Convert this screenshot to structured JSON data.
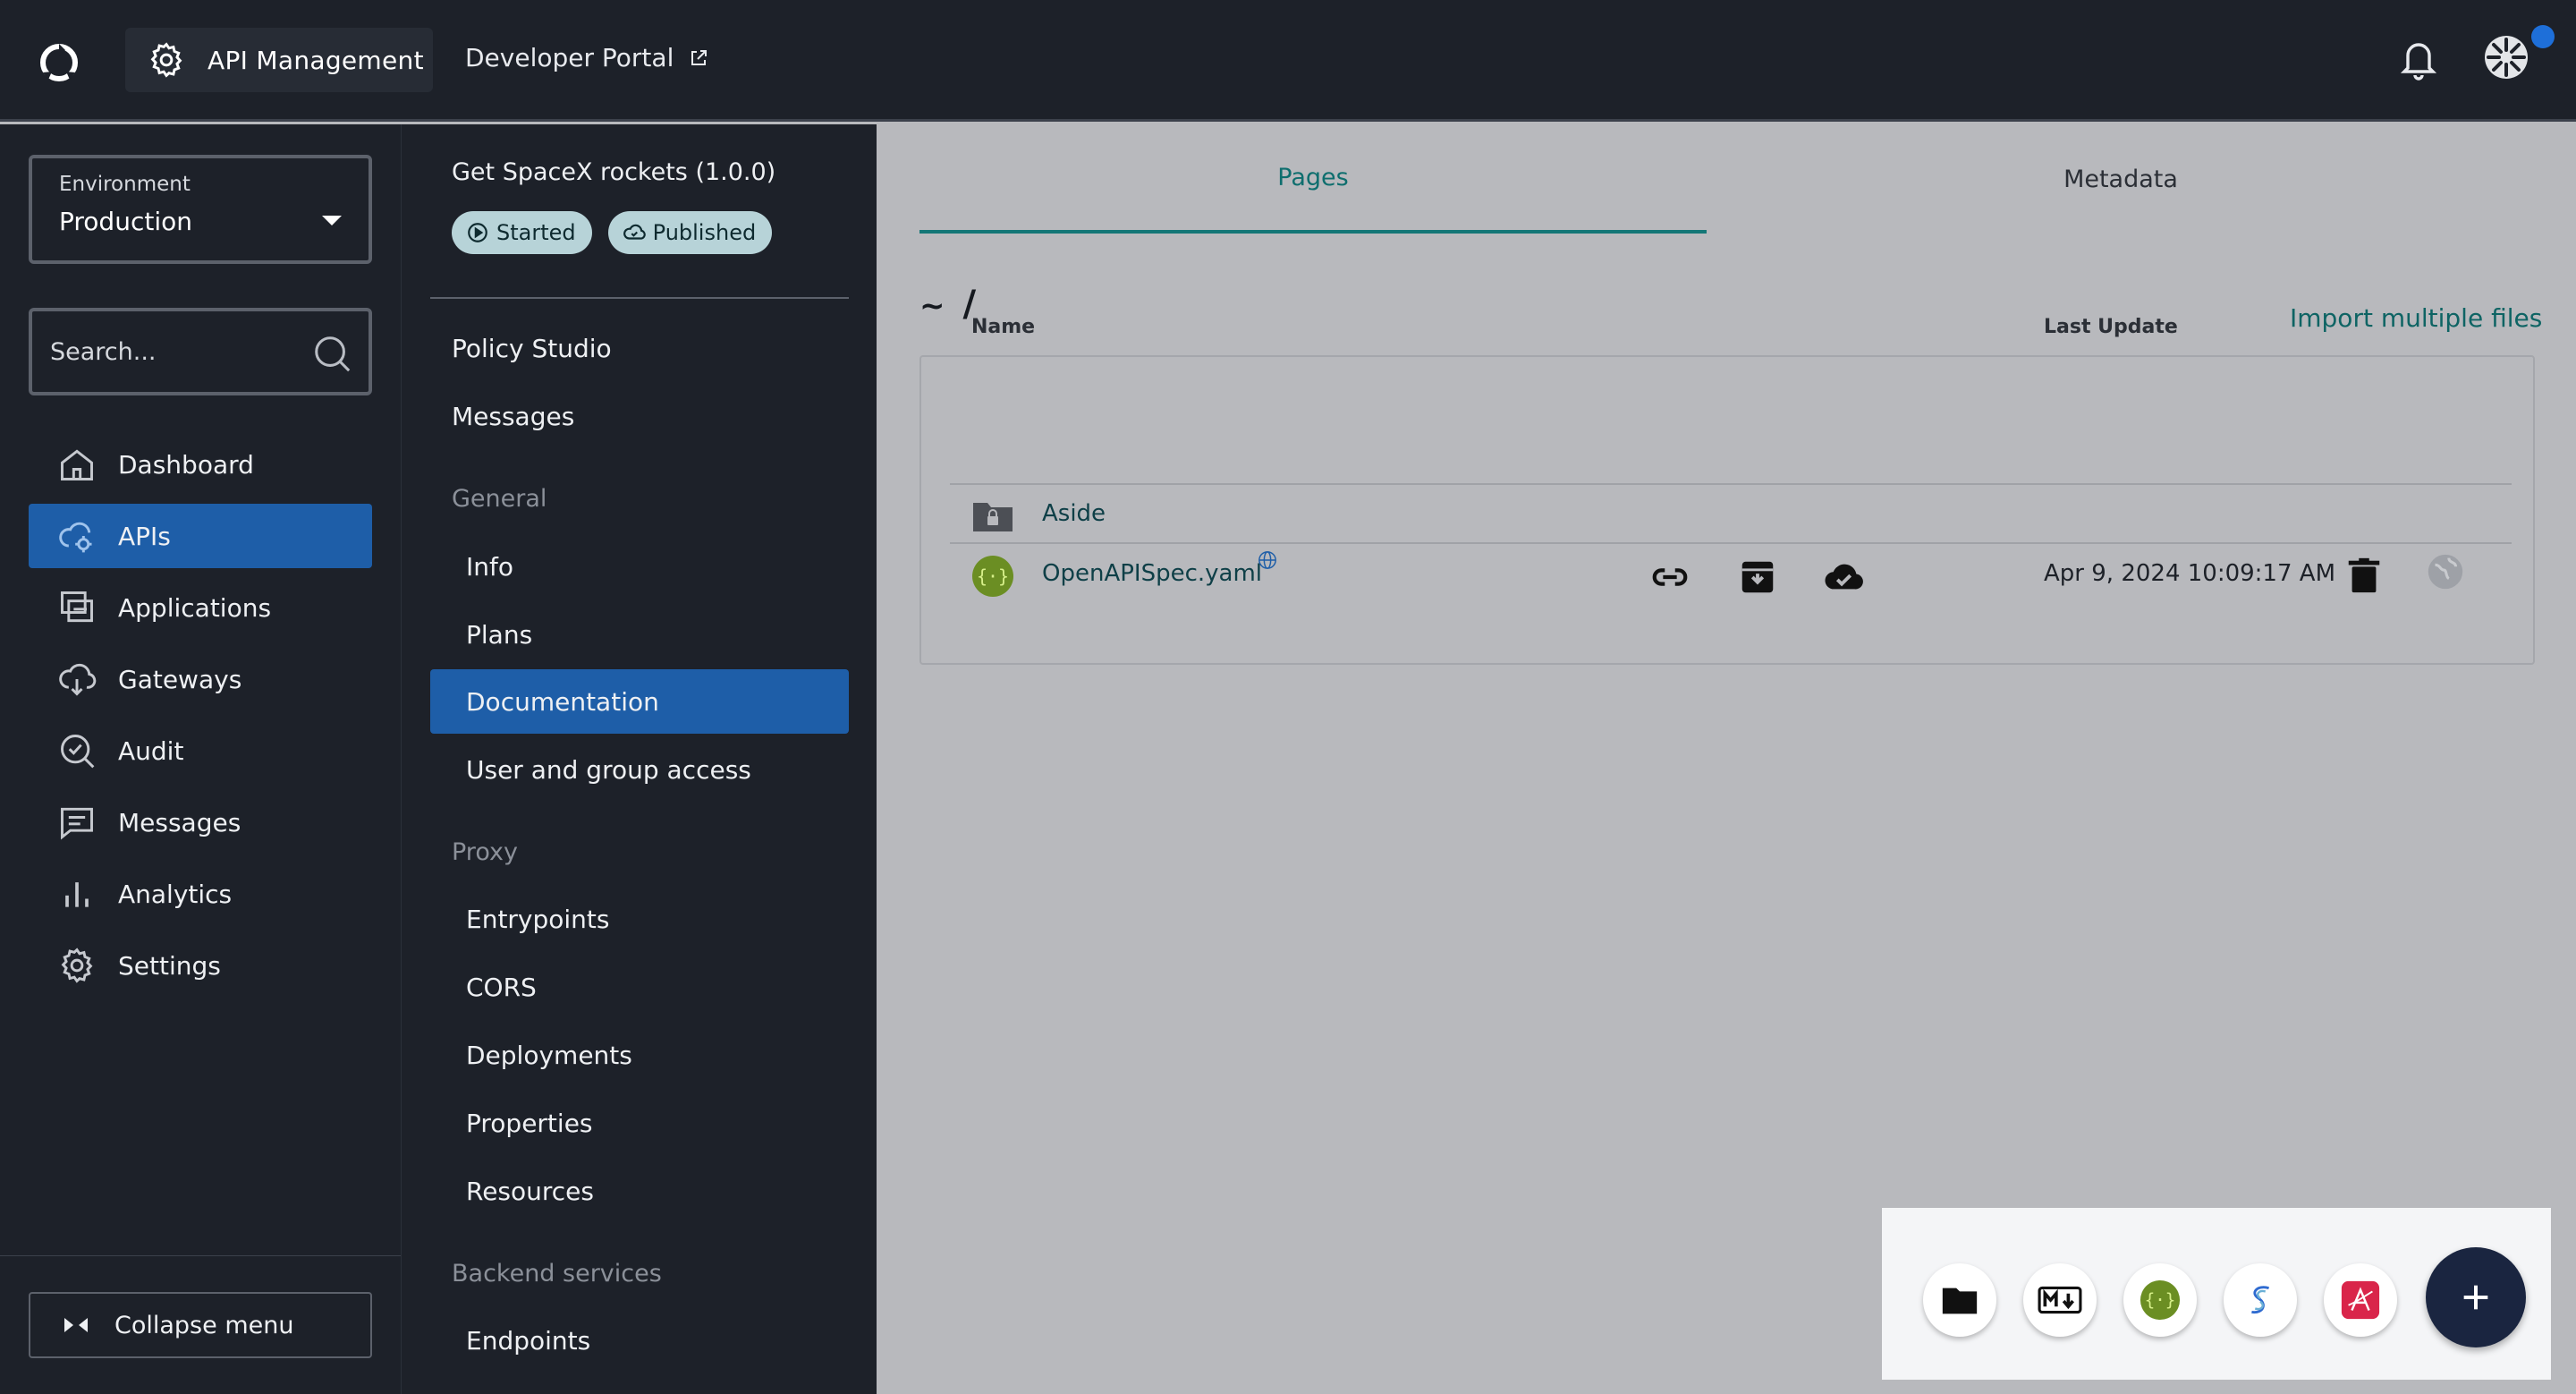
{
  "header": {
    "app_title": "API Management",
    "developer_portal": "Developer Portal"
  },
  "sidebar": {
    "environment_label": "Environment",
    "environment_value": "Production",
    "search_placeholder": "Search...",
    "items": [
      {
        "label": "Dashboard",
        "icon": "home-icon"
      },
      {
        "label": "APIs",
        "icon": "cloud-api-icon",
        "active": true
      },
      {
        "label": "Applications",
        "icon": "applications-icon"
      },
      {
        "label": "Gateways",
        "icon": "gateway-icon"
      },
      {
        "label": "Audit",
        "icon": "audit-icon"
      },
      {
        "label": "Messages",
        "icon": "message-icon"
      },
      {
        "label": "Analytics",
        "icon": "analytics-icon"
      },
      {
        "label": "Settings",
        "icon": "gear-icon"
      }
    ],
    "collapse_label": "Collapse menu"
  },
  "api_menu": {
    "title": "Get SpaceX rockets (1.0.0)",
    "badges": [
      "Started",
      "Published"
    ],
    "items": {
      "policy_studio": "Policy Studio",
      "messages": "Messages",
      "general_section": "General",
      "info": "Info",
      "plans": "Plans",
      "documentation": "Documentation",
      "user_group_access": "User and group access",
      "proxy_section": "Proxy",
      "entrypoints": "Entrypoints",
      "cors": "CORS",
      "deployments": "Deployments",
      "properties": "Properties",
      "resources": "Resources",
      "backend_section": "Backend services",
      "endpoints": "Endpoints"
    }
  },
  "main": {
    "tabs": [
      "Pages",
      "Metadata"
    ],
    "active_tab": "Pages",
    "path": {
      "root": "~",
      "separator": "/"
    },
    "import_link": "Import multiple files",
    "table": {
      "columns": {
        "name": "Name",
        "last_update": "Last Update"
      },
      "rows": [
        {
          "type": "folder",
          "name": "Aside",
          "last_update": ""
        },
        {
          "type": "openapi",
          "name": "OpenAPISpec.yaml",
          "last_update": "Apr 9, 2024 10:09:17 AM",
          "published": true
        }
      ]
    }
  },
  "fab_menu": {
    "options": [
      "folder-icon",
      "markdown-icon",
      "openapi-icon",
      "swagger-icon",
      "asyncapi-icon"
    ],
    "main": "plus-icon"
  },
  "colors": {
    "topbar": "#1d2129",
    "active_nav": "#1e5ea8",
    "accent_teal": "#147777",
    "badge_bg": "#b7d3d8",
    "notification_dot": "#1e6fd9"
  }
}
